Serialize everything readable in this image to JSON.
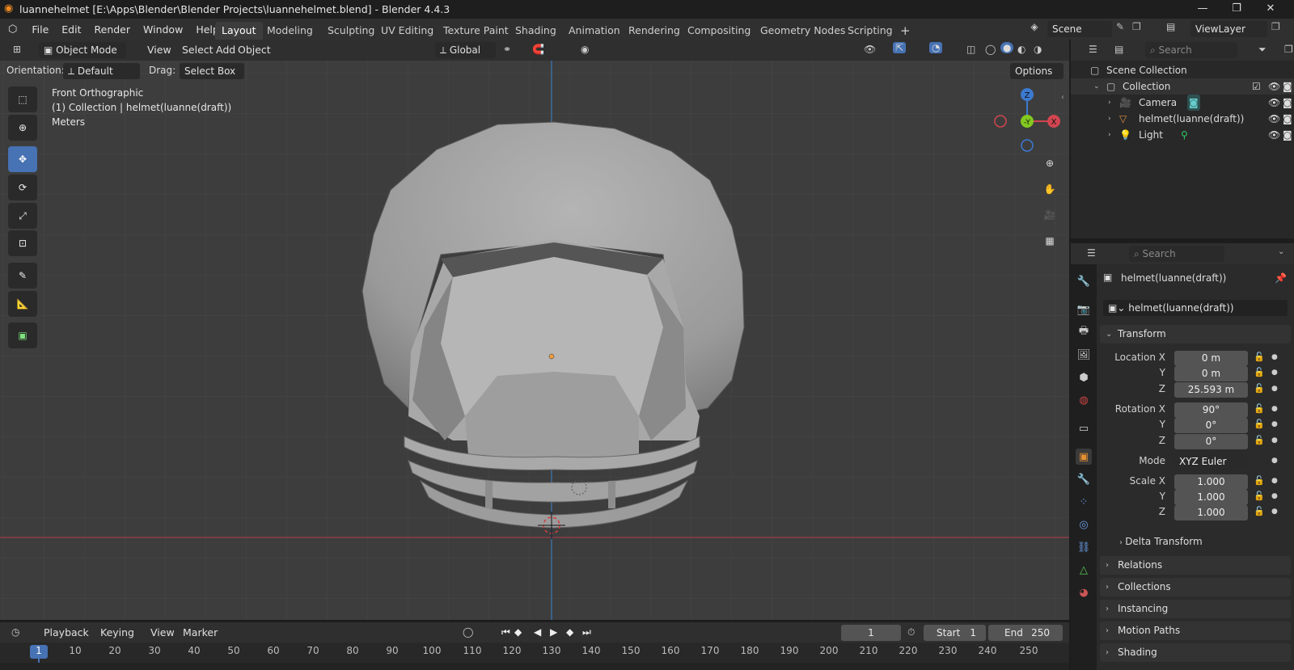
{
  "window": {
    "title": "luannehelmet [E:\\Apps\\Blender\\Blender Projects\\luannehelmet.blend] - Blender 4.4.3",
    "controls": [
      "—",
      "❐",
      "✕"
    ]
  },
  "menu": [
    "File",
    "Edit",
    "Render",
    "Window",
    "Help"
  ],
  "workspaces": [
    "Layout",
    "Modeling",
    "Sculpting",
    "UV Editing",
    "Texture Paint",
    "Shading",
    "Animation",
    "Rendering",
    "Compositing",
    "Geometry Nodes",
    "Scripting",
    "+"
  ],
  "scene": {
    "name": "Scene",
    "view_layer": "ViewLayer"
  },
  "viewport_header": {
    "mode": "Object Mode",
    "menus": [
      "View",
      "Select",
      "Add",
      "Object"
    ],
    "transform_orientation": "Global"
  },
  "tool_settings": {
    "orientation_label": "Orientation:",
    "orientation_value": "Default",
    "drag_label": "Drag:",
    "drag_value": "Select Box",
    "options": "Options"
  },
  "viewport_info": {
    "view": "Front Orthographic",
    "collection": "(1) Collection | helmet(luanne(draft))",
    "units": "Meters"
  },
  "gizmo": {
    "z": "Z",
    "y": "-Y",
    "x": "X"
  },
  "outliner": {
    "search_placeholder": "Search",
    "scene_collection": "Scene Collection",
    "collection": "Collection",
    "items": [
      "Camera",
      "helmet(luanne(draft))",
      "Light"
    ]
  },
  "properties": {
    "search_placeholder": "Search",
    "object_name": "helmet(luanne(draft))",
    "data_name": "helmet(luanne(draft))",
    "transform_label": "Transform",
    "location_label": "Location X",
    "location": [
      "0 m",
      "0 m",
      "25.593 m"
    ],
    "rotation_label": "Rotation X",
    "rotation": [
      "90°",
      "0°",
      "0°"
    ],
    "mode_label": "Mode",
    "mode": "XYZ Euler",
    "scale_label": "Scale X",
    "scale": [
      "1.000",
      "1.000",
      "1.000"
    ],
    "axis_y": "Y",
    "axis_z": "Z",
    "delta": "Delta Transform",
    "panels": [
      "Relations",
      "Collections",
      "Instancing",
      "Motion Paths",
      "Shading"
    ]
  },
  "timeline": {
    "menus": [
      "Playback",
      "Keying",
      "View",
      "Marker"
    ],
    "current_frame": "1",
    "start_label": "Start",
    "start": "1",
    "end_label": "End",
    "end": "250",
    "ticks": [
      "1",
      "10",
      "20",
      "30",
      "40",
      "50",
      "60",
      "70",
      "80",
      "90",
      "100",
      "110",
      "120",
      "130",
      "140",
      "150",
      "160",
      "170",
      "180",
      "190",
      "200",
      "210",
      "220",
      "230",
      "240",
      "250"
    ]
  }
}
